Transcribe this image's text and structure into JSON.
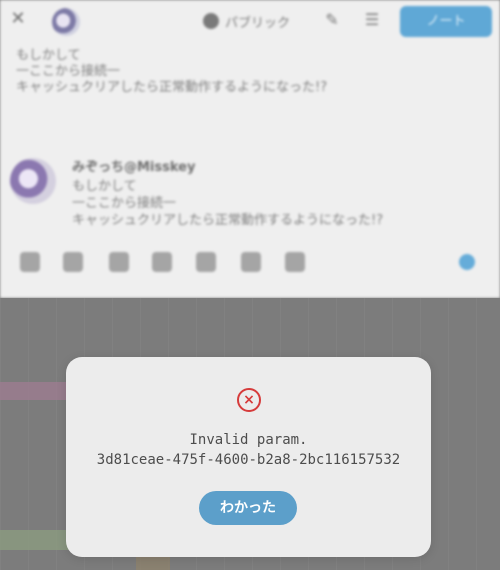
{
  "composer": {
    "header": {
      "visibility_label": "パブリック",
      "post_button_label": "ノート"
    },
    "draft_text": "もしかして\n一ここから接続一\nキャッシュクリアしたら正常動作するようになった!?",
    "preview": {
      "name": "みぞっち@Misskey",
      "text": "もしかして\n一ここから接続一\nキャッシュクリアしたら正常動作するようになった!?"
    }
  },
  "dialog": {
    "message": "Invalid param.\n3d81ceae-475f-4600-b2a8-2bc116157532",
    "button_label": "わかった",
    "icon": "error-icon"
  },
  "colors": {
    "accent": "#5c9fca",
    "error": "#d63b3b",
    "dialog_bg": "#ececec"
  }
}
